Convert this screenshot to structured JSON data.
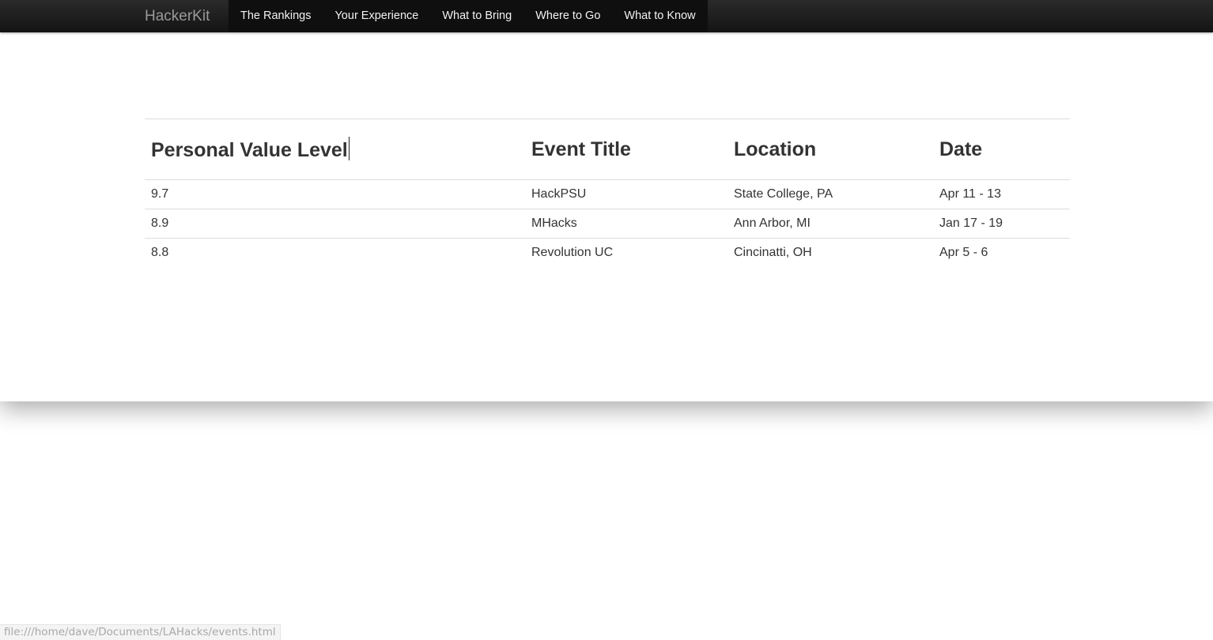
{
  "navbar": {
    "brand": "HackerKit",
    "items": [
      "The Rankings",
      "Your Experience",
      "What to Bring",
      "Where to Go",
      "What to Know"
    ]
  },
  "table": {
    "headers": [
      "Personal Value Level",
      "Event Title",
      "Location",
      "Date"
    ],
    "rows": [
      [
        "9.7",
        "HackPSU",
        "State College, PA",
        "Apr 11 - 13"
      ],
      [
        "8.9",
        "MHacks",
        "Ann Arbor, MI",
        "Jan 17 - 19"
      ],
      [
        "8.8",
        "Revolution UC",
        "Cincinatti, OH",
        "Apr 5 - 6"
      ]
    ]
  },
  "statusbar": {
    "url": "file:///home/dave/Documents/LAHacks/events.html"
  }
}
